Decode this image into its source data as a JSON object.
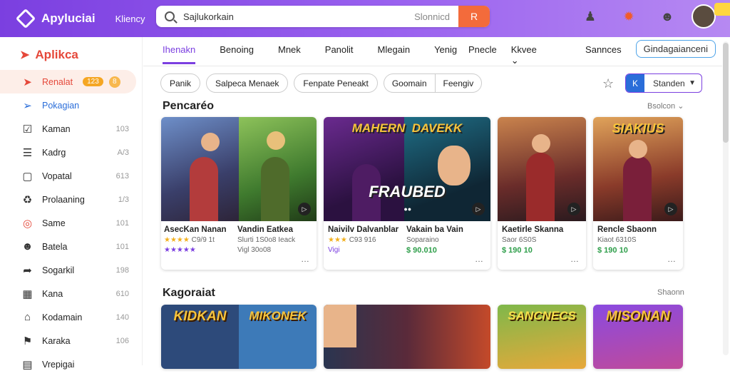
{
  "header": {
    "brand": "Apyluciai",
    "subtitle": "Kliency",
    "search_value": "Sajlukorkain",
    "search_hint": "Slonnicd",
    "go_label": "R",
    "icons": [
      "user-icon",
      "flame-icon",
      "robot-icon"
    ],
    "avatar_initials": ""
  },
  "sidebar": {
    "title": "Aplikca",
    "items": [
      {
        "label": "Renalat",
        "count": "",
        "icon": "megaphone-icon",
        "badge": "123",
        "badge2": "8"
      },
      {
        "label": "Pokagian",
        "count": "",
        "icon": "rocket-icon"
      },
      {
        "label": "Kaman",
        "count": "103",
        "icon": "checkbox-icon"
      },
      {
        "label": "Kadrg",
        "count": "A/3",
        "icon": "list-icon"
      },
      {
        "label": "Vopatal",
        "count": "613",
        "icon": "document-icon"
      },
      {
        "label": "Prolaaning",
        "count": "1/3",
        "icon": "bag-icon"
      },
      {
        "label": "Same",
        "count": "101",
        "icon": "circle-icon"
      },
      {
        "label": "Batela",
        "count": "101",
        "icon": "person-icon"
      },
      {
        "label": "Sogarkil",
        "count": "198",
        "icon": "share-icon"
      },
      {
        "label": "Kana",
        "count": "610",
        "icon": "grid-icon"
      },
      {
        "label": "Kodamain",
        "count": "140",
        "icon": "house-icon"
      },
      {
        "label": "Karaka",
        "count": "106",
        "icon": "bookmark-icon"
      },
      {
        "label": "Vrepigai",
        "count": "",
        "icon": "folder-icon"
      }
    ]
  },
  "tabs": [
    "Ihenakn",
    "Benoing",
    "Mnek",
    "Panolit",
    "Mlegain",
    "Yenig"
  ],
  "right_tabs": {
    "a": "Pnecle",
    "b": "Kkvee",
    "c": "Sannces",
    "d": "Gindagaianceni"
  },
  "chips": [
    "Panik",
    "Salpeca Menaek",
    "Fenpate Peneakt"
  ],
  "chip_group": [
    "Goomain",
    "Feengiv"
  ],
  "sort": {
    "icon_label": "K",
    "label": "Standen"
  },
  "section1": {
    "title": "Pencaréo",
    "link": "Bsolcon"
  },
  "section2": {
    "title": "Kagoraiat",
    "link": "Shaonn"
  },
  "cards": [
    {
      "title": "AsecKan Nanan",
      "sub": "",
      "stars": "★★★★",
      "rating": "C9/9 1t",
      "title2": "Vandin Eatkea",
      "sub2": "Slurti 1S0o8 Ieack",
      "price": "★★★★★",
      "price2": "Vigl 30o08",
      "logo": ""
    },
    {
      "title": "Naivilv Dalvanblar",
      "sub": "",
      "stars": "★★★",
      "rating": "C93 916",
      "title2": "Vakain ba Vain",
      "sub2": "Soparaino",
      "price": "Vigi",
      "price2": "$ 90.010",
      "logo": "FRAUBED",
      "logo_top": "MAHERN",
      "logo_top2": "DAVEKK"
    },
    {
      "title": "Kaetirle Skanna",
      "sub": "Saor 6S0S",
      "price": "$ 190 10",
      "logo": ""
    },
    {
      "title": "Rencle Sbaonn",
      "sub": "Kiaot 6310S",
      "price": "$ 190 10",
      "logo_top": "SIAKIUS"
    }
  ],
  "cards_row2": [
    "KIDKAN",
    "MIKONEK",
    "",
    "SANCNECS",
    "MISONAN"
  ]
}
